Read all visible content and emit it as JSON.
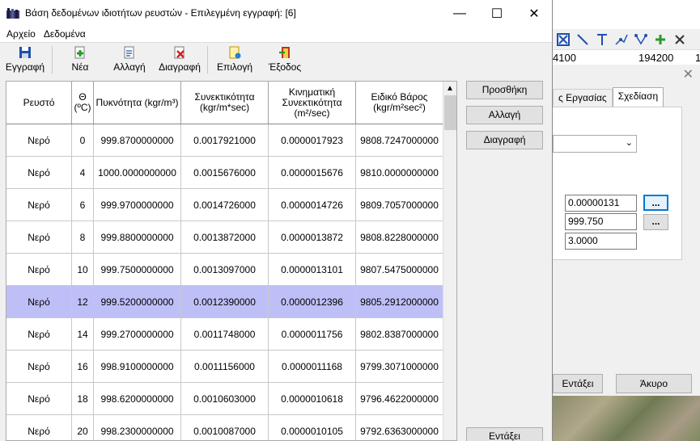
{
  "window": {
    "title": "Βάση δεδομένων ιδιοτήτων ρευστών - Επιλεγμένη εγγραφή: [6]",
    "minimize": "—",
    "maximize": "☐",
    "close": "✕"
  },
  "menu": [
    {
      "label": "Αρχείο"
    },
    {
      "label": "Δεδομένα"
    }
  ],
  "toolbar": {
    "record": "Εγγραφή",
    "new": "Νέα",
    "edit": "Αλλαγή",
    "delete": "Διαγραφή",
    "select": "Επιλογή",
    "exit": "Έξοδος"
  },
  "grid": {
    "columns": [
      "Ρευστό",
      "Θ (ºC)",
      "Πυκνότητα (kgr/m³)",
      "Συνεκτικότητα (kgr/m*sec)",
      "Κινηματική Συνεκτικότητα (m²/sec)",
      "Ειδικό Βάρος (kgr/m²sec²)"
    ],
    "rows": [
      [
        "Νερό",
        "0",
        "999.8700000000",
        "0.0017921000",
        "0.0000017923",
        "9808.7247000000"
      ],
      [
        "Νερό",
        "4",
        "1000.0000000000",
        "0.0015676000",
        "0.0000015676",
        "9810.0000000000"
      ],
      [
        "Νερό",
        "6",
        "999.9700000000",
        "0.0014726000",
        "0.0000014726",
        "9809.7057000000"
      ],
      [
        "Νερό",
        "8",
        "999.8800000000",
        "0.0013872000",
        "0.0000013872",
        "9808.8228000000"
      ],
      [
        "Νερό",
        "10",
        "999.7500000000",
        "0.0013097000",
        "0.0000013101",
        "9807.5475000000"
      ],
      [
        "Νερό",
        "12",
        "999.5200000000",
        "0.0012390000",
        "0.0000012396",
        "9805.2912000000"
      ],
      [
        "Νερό",
        "14",
        "999.2700000000",
        "0.0011748000",
        "0.0000011756",
        "9802.8387000000"
      ],
      [
        "Νερό",
        "16",
        "998.9100000000",
        "0.0011156000",
        "0.0000011168",
        "9799.3071000000"
      ],
      [
        "Νερό",
        "18",
        "998.6200000000",
        "0.0010603000",
        "0.0000010618",
        "9796.4622000000"
      ],
      [
        "Νερό",
        "20",
        "998.2300000000",
        "0.0010087000",
        "0.0000010105",
        "9792.6363000000"
      ]
    ],
    "selected_row": 5
  },
  "side_buttons": {
    "add": "Προσθήκη",
    "change": "Αλλαγή",
    "delete": "Διαγραφή",
    "insert": "Εντάξει"
  },
  "background": {
    "coords": [
      "4100",
      "194200",
      "1"
    ],
    "tabs": [
      "ς Εργασίας",
      "Σχεδίαση"
    ],
    "fields": [
      "0.00000131",
      "999.750",
      "3.0000"
    ],
    "browse": "...",
    "ok": "Εντάξει",
    "cancel": "Άκυρο",
    "close": "✕",
    "combo_arrow": "⌄"
  },
  "colors": {
    "selected_row": "#bfbff8",
    "accent": "#0078d7"
  }
}
